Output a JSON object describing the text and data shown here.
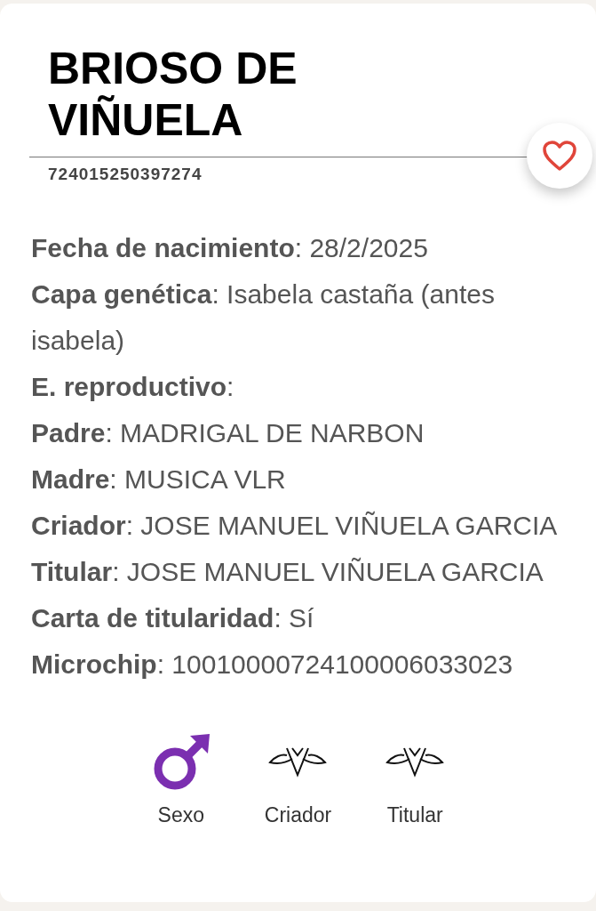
{
  "title": "BRIOSO DE VIÑUELA",
  "registration": "724015250397274",
  "fields": [
    "**Fecha de nacimiento**: 28/2/2025",
    "**Capa genética**: Isabela castaña (antes isabela)",
    "**E. reproductivo**:",
    "**Padre**: MADRIGAL DE NARBON",
    "**Madre**: MUSICA VLR",
    "**Criador**: JOSE MANUEL VIÑUELA GARCIA",
    "**Titular**: JOSE MANUEL VIÑUELA GARCIA",
    "**Carta de titularidad**: Sí",
    "**Microchip**: 10010000724100006033023"
  ],
  "actions": [
    {
      "kind": "male",
      "label": "Sexo"
    },
    {
      "kind": "brand",
      "label": "Criador"
    },
    {
      "kind": "brand",
      "label": "Titular"
    }
  ]
}
